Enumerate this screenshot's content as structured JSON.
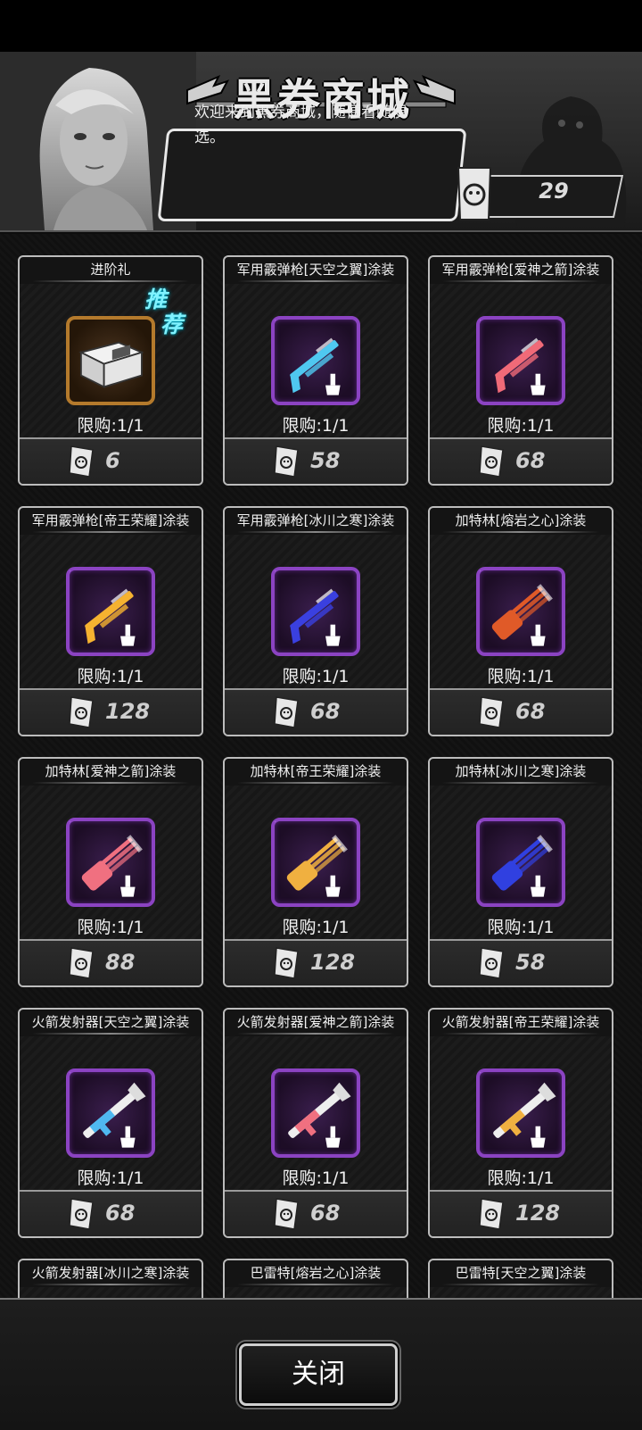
{
  "header": {
    "title": "黑券商城",
    "greeting": "欢迎来到黑券商城，随便看随便选。",
    "currency_amount": "29",
    "currency_icon": "black-ticket-icon"
  },
  "colors": {
    "rarity_purple": "#8b43c2",
    "rarity_orange": "#b47a2c",
    "recommend_tag": "#7ff2ff"
  },
  "items": [
    {
      "name": "进阶礼",
      "limit": "限购:1/1",
      "price": "6",
      "tag": "推荐",
      "rarity": "orange",
      "icon": "supply-crate-icon"
    },
    {
      "name": "军用霰弹枪[天空之翼]涂装",
      "limit": "限购:1/1",
      "price": "58",
      "rarity": "purple",
      "icon": "shotgun-skin-icon",
      "color": "#4fc8f0"
    },
    {
      "name": "军用霰弹枪[爱神之箭]涂装",
      "limit": "限购:1/1",
      "price": "68",
      "rarity": "purple",
      "icon": "shotgun-skin-icon",
      "color": "#f06a78"
    },
    {
      "name": "军用霰弹枪[帝王荣耀]涂装",
      "limit": "限购:1/1",
      "price": "128",
      "rarity": "purple",
      "icon": "shotgun-skin-icon",
      "color": "#f5b230"
    },
    {
      "name": "军用霰弹枪[冰川之寒]涂装",
      "limit": "限购:1/1",
      "price": "68",
      "rarity": "purple",
      "icon": "shotgun-skin-icon",
      "color": "#3a40e0"
    },
    {
      "name": "加特林[熔岩之心]涂装",
      "limit": "限购:1/1",
      "price": "68",
      "rarity": "purple",
      "icon": "gatling-skin-icon",
      "color": "#e05a28"
    },
    {
      "name": "加特林[爱神之箭]涂装",
      "limit": "限购:1/1",
      "price": "88",
      "rarity": "purple",
      "icon": "gatling-skin-icon",
      "color": "#f07080"
    },
    {
      "name": "加特林[帝王荣耀]涂装",
      "limit": "限购:1/1",
      "price": "128",
      "rarity": "purple",
      "icon": "gatling-skin-icon",
      "color": "#f0b040"
    },
    {
      "name": "加特林[冰川之寒]涂装",
      "limit": "限购:1/1",
      "price": "58",
      "rarity": "purple",
      "icon": "gatling-skin-icon",
      "color": "#3040e0"
    },
    {
      "name": "火箭发射器[天空之翼]涂装",
      "limit": "限购:1/1",
      "price": "68",
      "rarity": "purple",
      "icon": "rocket-launcher-skin-icon",
      "color": "#4fb8f0"
    },
    {
      "name": "火箭发射器[爱神之箭]涂装",
      "limit": "限购:1/1",
      "price": "68",
      "rarity": "purple",
      "icon": "rocket-launcher-skin-icon",
      "color": "#f07080"
    },
    {
      "name": "火箭发射器[帝王荣耀]涂装",
      "limit": "限购:1/1",
      "price": "128",
      "rarity": "purple",
      "icon": "rocket-launcher-skin-icon",
      "color": "#f0b040"
    },
    {
      "name": "火箭发射器[冰川之寒]涂装",
      "rarity": "purple"
    },
    {
      "name": "巴雷特[熔岩之心]涂装",
      "rarity": "purple"
    },
    {
      "name": "巴雷特[天空之翼]涂装",
      "rarity": "purple"
    }
  ],
  "footer": {
    "close_label": "关闭"
  }
}
